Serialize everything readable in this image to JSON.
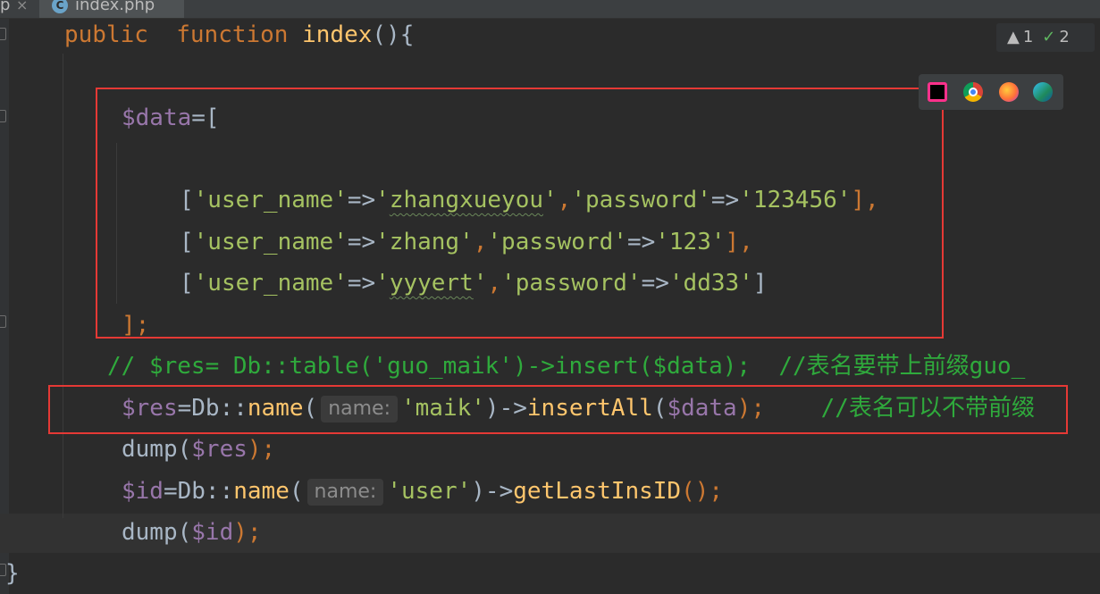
{
  "tabs": {
    "left_tab_label": "p",
    "close_glyph": "×",
    "active_tab_label": "index.php",
    "active_tab_icon": "C"
  },
  "inspections": {
    "warnings": "1",
    "weak_warnings": "2"
  },
  "browsers": [
    "phpstorm-icon",
    "chrome-icon",
    "firefox-icon",
    "edge-icon"
  ],
  "code": {
    "l1_kw1": "public",
    "l1_kw2": "function",
    "l1_fn": "index",
    "l1_rest": "(){",
    "l2_var": "$data",
    "l2_rest": "=[",
    "l3": {
      "p1": "[",
      "s1": "'user_name'",
      "op1": "=>",
      "s2a": "'",
      "s2b": "zhangxueyou",
      "s2c": "'",
      "c1": ",",
      "s3": "'password'",
      "op2": "=>",
      "s4": "'123456'",
      "p2": "],"
    },
    "l4": {
      "p1": "[",
      "s1": "'user_name'",
      "op1": "=>",
      "s2": "'zhang'",
      "c1": ",",
      "s3": "'password'",
      "op2": "=>",
      "s4": "'123'",
      "p2": "],"
    },
    "l5": {
      "p1": "[",
      "s1": "'user_name'",
      "op1": "=>",
      "s2a": "'",
      "s2b": "yyyert",
      "s2c": "'",
      "c1": ",",
      "s3": "'password'",
      "op2": "=>",
      "s4": "'dd33'",
      "p2": "]"
    },
    "l6": "];",
    "l7": "// $res= Db::table('guo_maik')->insert($data);  //表名要带上前缀guo_",
    "l8": {
      "var": "$res",
      "eq": "=Db::",
      "fn": "name",
      "open": "(",
      "hint": "name:",
      "str": "'maik'",
      "arrow": ")->",
      "fn2": "insertAll",
      "open2": "(",
      "var2": "$data",
      "close": ");",
      "cmt": "//表名可以不带前缀"
    },
    "l9": {
      "fn": "dump",
      "open": "(",
      "var": "$res",
      "close": ");"
    },
    "l10": {
      "var": "$id",
      "eq": "=Db::",
      "fn": "name",
      "open": "(",
      "hint": "name:",
      "str": "'user'",
      "arrow": ")->",
      "fn2": "getLastInsID",
      "close": "();"
    },
    "l11": {
      "fn": "dump",
      "open": "(",
      "var": "$id",
      "close": ");"
    },
    "l12": "}"
  }
}
